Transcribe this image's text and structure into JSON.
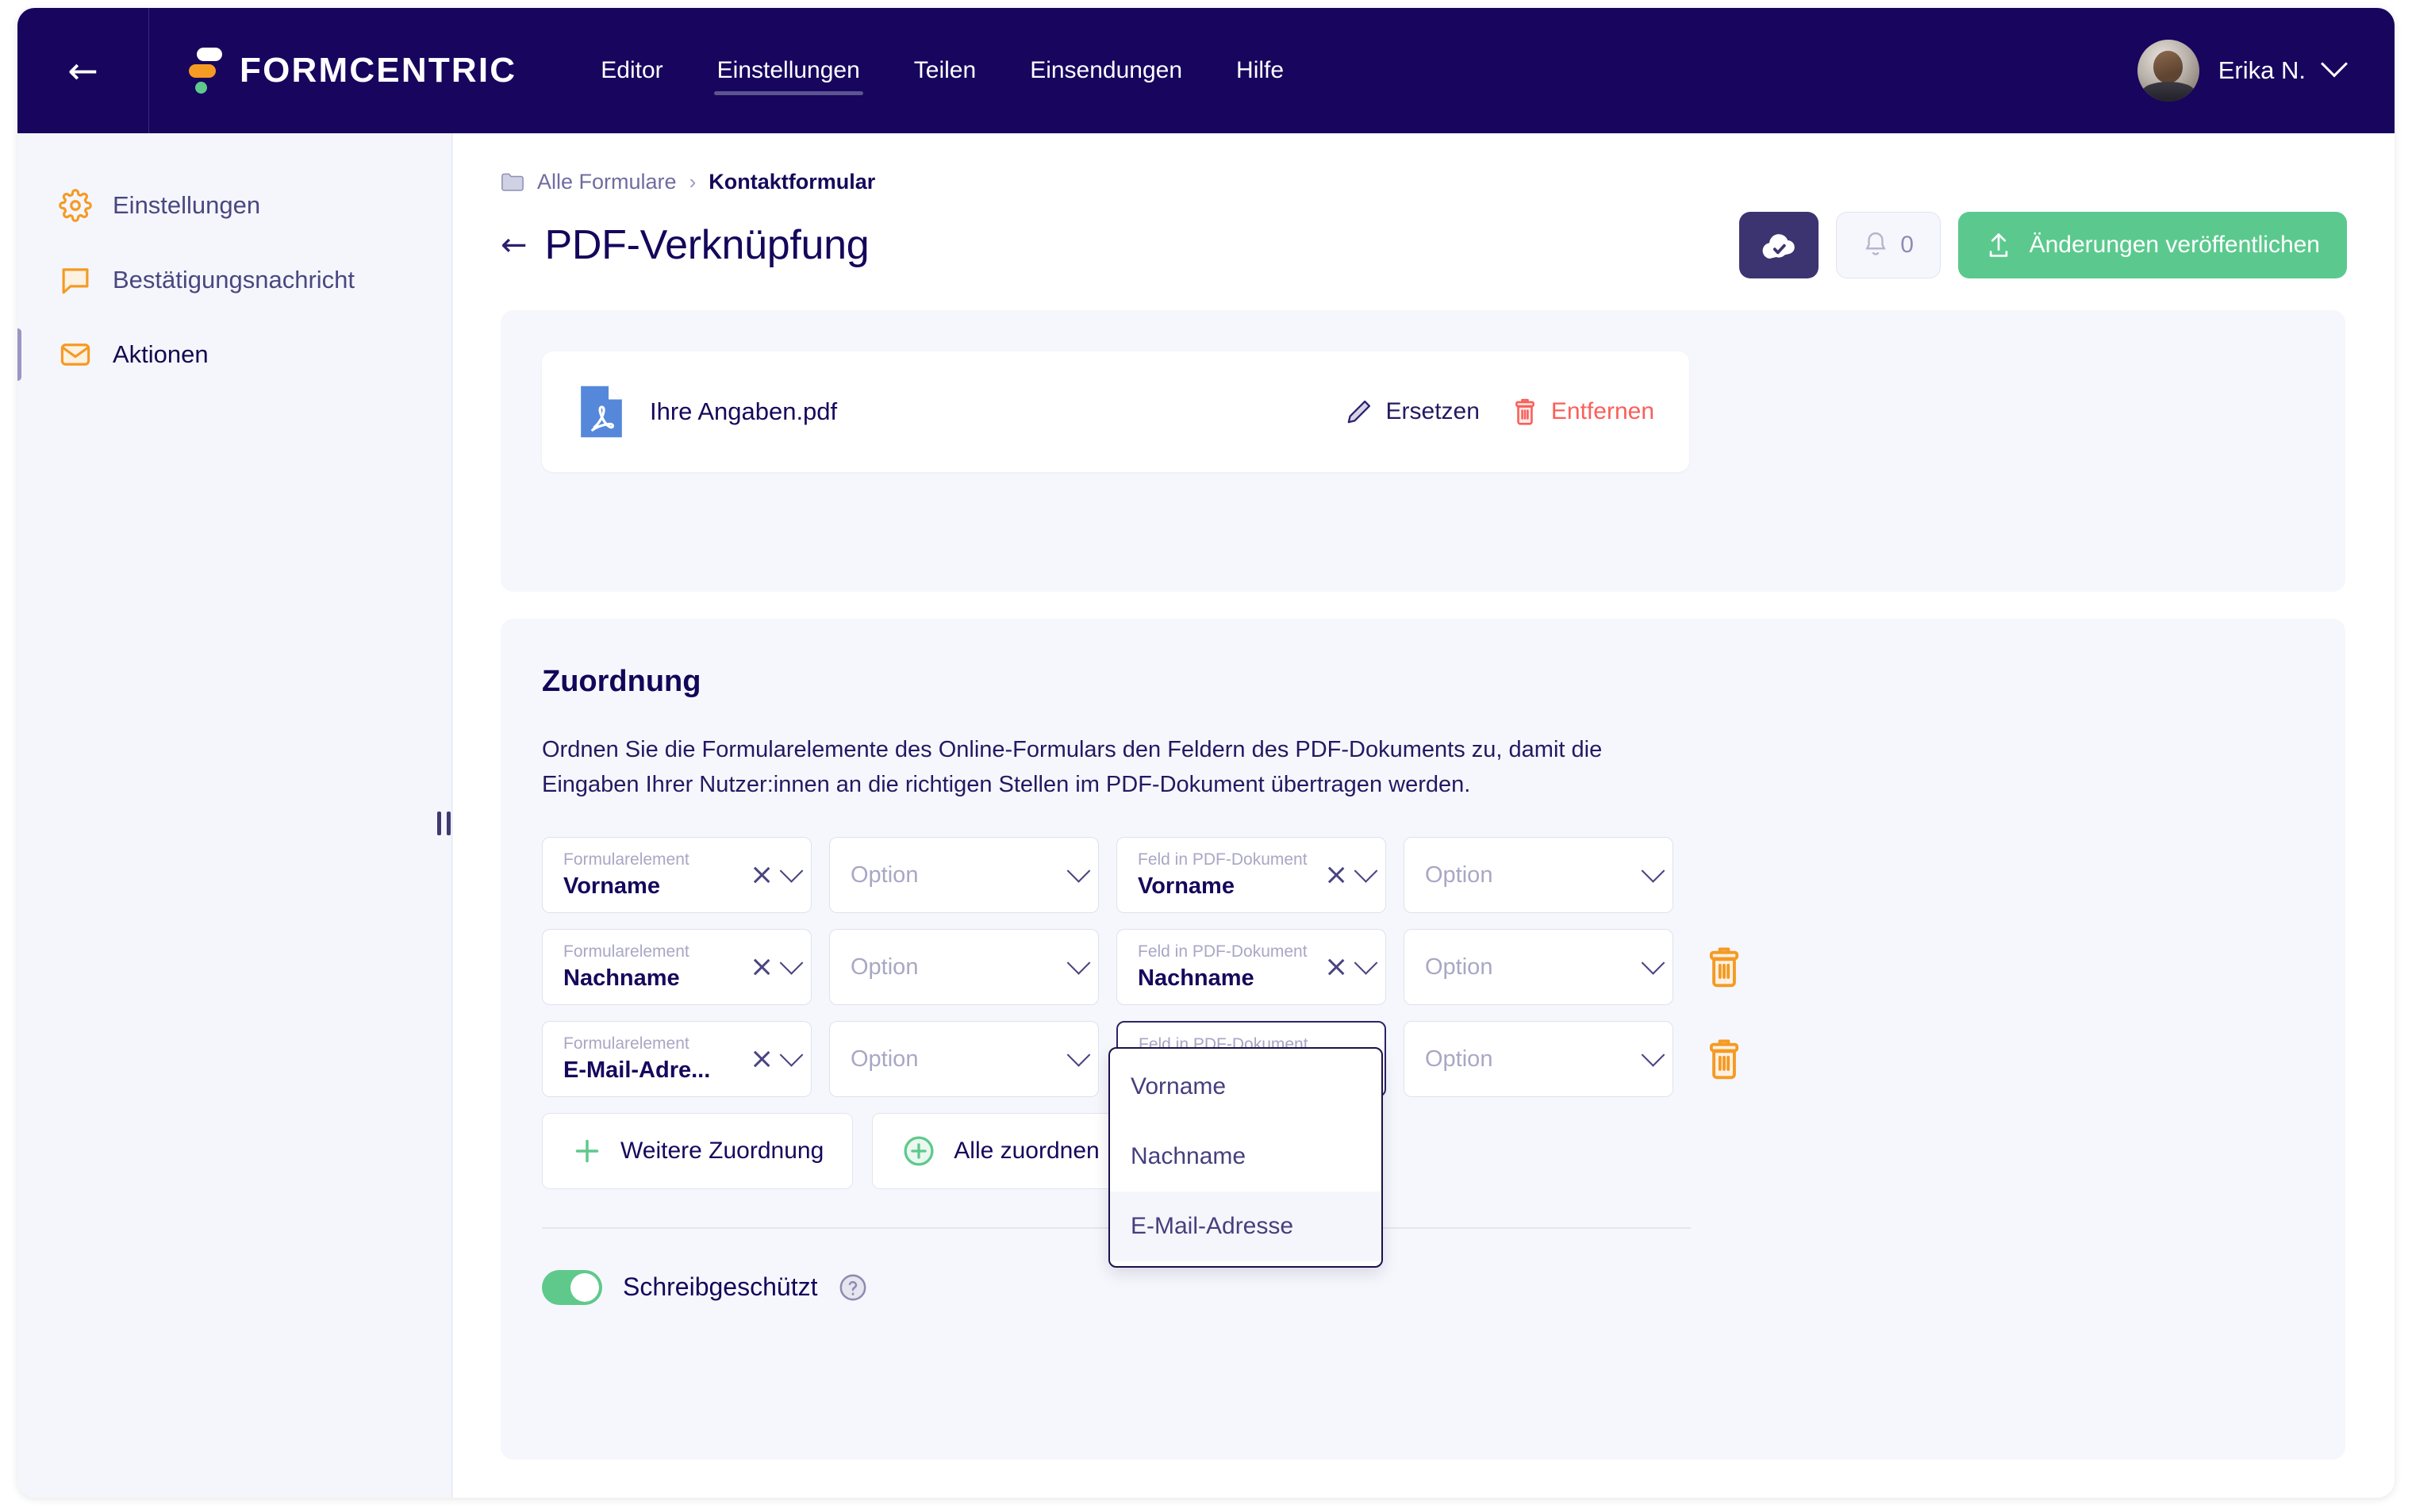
{
  "topbar": {
    "back_icon": "arrow-left-icon",
    "brand": "FORMCENTRIC",
    "nav": [
      {
        "label": "Editor",
        "active": false
      },
      {
        "label": "Einstellungen",
        "active": true
      },
      {
        "label": "Teilen",
        "active": false
      },
      {
        "label": "Einsendungen",
        "active": false
      },
      {
        "label": "Hilfe",
        "active": false
      }
    ],
    "user": {
      "name": "Erika N."
    }
  },
  "sidebar": {
    "items": [
      {
        "label": "Einstellungen",
        "icon": "gear-icon",
        "active": false
      },
      {
        "label": "Bestätigungsnachricht",
        "icon": "speech-bubble-icon",
        "active": false
      },
      {
        "label": "Aktionen",
        "icon": "envelope-icon",
        "active": true
      }
    ]
  },
  "breadcrumb": {
    "folder_icon": "folder-icon",
    "root": "Alle Formulare",
    "separator": "›",
    "current": "Kontaktformular"
  },
  "header": {
    "back_icon": "arrow-left-icon",
    "title": "PDF-Verknüpfung",
    "actions": {
      "cloud_icon": "cloud-check-icon",
      "bell_icon": "bell-icon",
      "bell_count": "0",
      "publish_icon": "upload-icon",
      "publish_label": "Änderungen veröffentlichen"
    }
  },
  "file_card": {
    "icon": "pdf-file-icon",
    "name": "Ihre Angaben.pdf",
    "replace_label": "Ersetzen",
    "replace_icon": "pencil-icon",
    "remove_label": "Entfernen",
    "remove_icon": "trash-icon"
  },
  "mapping": {
    "section_title": "Zuordnung",
    "description": "Ordnen Sie die Formularelemente des Online-Formulars den Feldern des PDF-Dokuments zu, damit die Eingaben Ihrer Nutzer:innen an die richtigen Stellen im PDF-Dokument übertragen werden.",
    "labels": {
      "form_element": "Formularelement",
      "pdf_field": "Feld in PDF-Dokument",
      "option_placeholder": "Option"
    },
    "rows": [
      {
        "form_element": "Vorname",
        "option_left": "Option",
        "pdf_field": "Vorname",
        "option_right": "Option",
        "has_trash": false
      },
      {
        "form_element": "Nachname",
        "option_left": "Option",
        "pdf_field": "Nachname",
        "option_right": "Option",
        "has_trash": true
      },
      {
        "form_element": "E-Mail-Adre...",
        "option_left": "Option",
        "pdf_field": "",
        "option_right": "Option",
        "has_trash": true
      }
    ],
    "dropdown": {
      "open": true,
      "options": [
        {
          "label": "Vorname",
          "selected": false
        },
        {
          "label": "Nachname",
          "selected": false
        },
        {
          "label": "E-Mail-Adresse",
          "selected": true
        }
      ]
    },
    "add_buttons": [
      {
        "label": "Weitere Zuordnung",
        "icon": "plus-icon"
      },
      {
        "label": "Alle zuordnen",
        "icon": "plus-circle-icon"
      }
    ],
    "toggle": {
      "label": "Schreibgeschützt",
      "on": true,
      "help_icon": "question-circle-icon"
    }
  },
  "colors": {
    "brand_navy": "#17055e",
    "accent_orange": "#f59a23",
    "accent_green": "#5ec98b",
    "danger_red": "#f9605a",
    "purple": "#3c3470"
  }
}
